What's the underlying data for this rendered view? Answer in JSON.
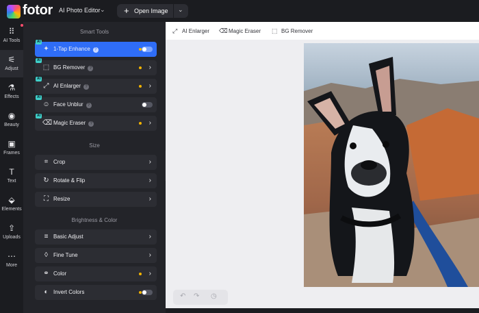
{
  "app": {
    "logo_text": "fotor",
    "editor_mode": "AI Photo Editor",
    "open_image_label": "Open Image",
    "accent": "#2f6df6",
    "ai_badge": "AI"
  },
  "rail": [
    {
      "label": "AI Tools",
      "icon": "grid-icon"
    },
    {
      "label": "Adjust",
      "icon": "sliders-icon",
      "active": true
    },
    {
      "label": "Effects",
      "icon": "flask-icon"
    },
    {
      "label": "Beauty",
      "icon": "eye-icon"
    },
    {
      "label": "Frames",
      "icon": "frame-icon"
    },
    {
      "label": "Text",
      "icon": "text-icon"
    },
    {
      "label": "Elements",
      "icon": "shapes-icon"
    },
    {
      "label": "Uploads",
      "icon": "upload-icon"
    },
    {
      "label": "More",
      "icon": "more-icon"
    }
  ],
  "panel": {
    "sections": {
      "smart_tools": "Smart Tools",
      "size": "Size",
      "brightness_color": "Brightness & Color"
    },
    "smart_tools": [
      {
        "label": "1-Tap Enhance",
        "ai": true,
        "help": "?",
        "toggle": true,
        "toggled": true,
        "active": true
      },
      {
        "label": "BG Remover",
        "ai": true,
        "help": "?"
      },
      {
        "label": "AI Enlarger",
        "ai": true,
        "help": "?"
      },
      {
        "label": "Face Unblur",
        "ai": true,
        "help": "?",
        "toggle": true
      },
      {
        "label": "Magic Eraser",
        "ai": true,
        "help": "?"
      }
    ],
    "size_tools": [
      {
        "label": "Crop"
      },
      {
        "label": "Rotate & Flip"
      },
      {
        "label": "Resize"
      }
    ],
    "color_tools": [
      {
        "label": "Basic Adjust"
      },
      {
        "label": "Fine Tune"
      },
      {
        "label": "Color"
      },
      {
        "label": "Invert Colors",
        "toggle": true
      }
    ]
  },
  "subbar": {
    "ai_enlarger": "AI Enlarger",
    "magic_eraser": "Magic Eraser",
    "bg_remover": "BG Remover"
  }
}
